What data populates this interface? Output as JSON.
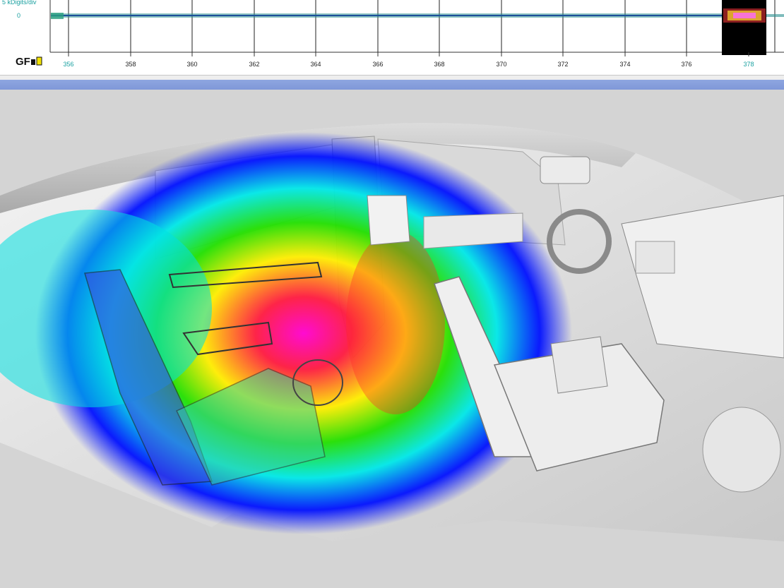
{
  "timeline": {
    "scale_label": "5 kDigits/div",
    "zero_label": "0",
    "ticks": [
      "356",
      "358",
      "360",
      "362",
      "364",
      "366",
      "368",
      "370",
      "372",
      "374",
      "376",
      "378"
    ],
    "active_ticks": [
      "356",
      "378"
    ],
    "logo_text": "GFaI",
    "selection_color": "#000000",
    "accent": "#1aa0a0"
  },
  "colors": {
    "divider_bar": "#8ea6e0",
    "viewport_bg": "#d4d4d4",
    "heat_hot": "#ff00cc",
    "heat_cold": "#0000ff"
  }
}
